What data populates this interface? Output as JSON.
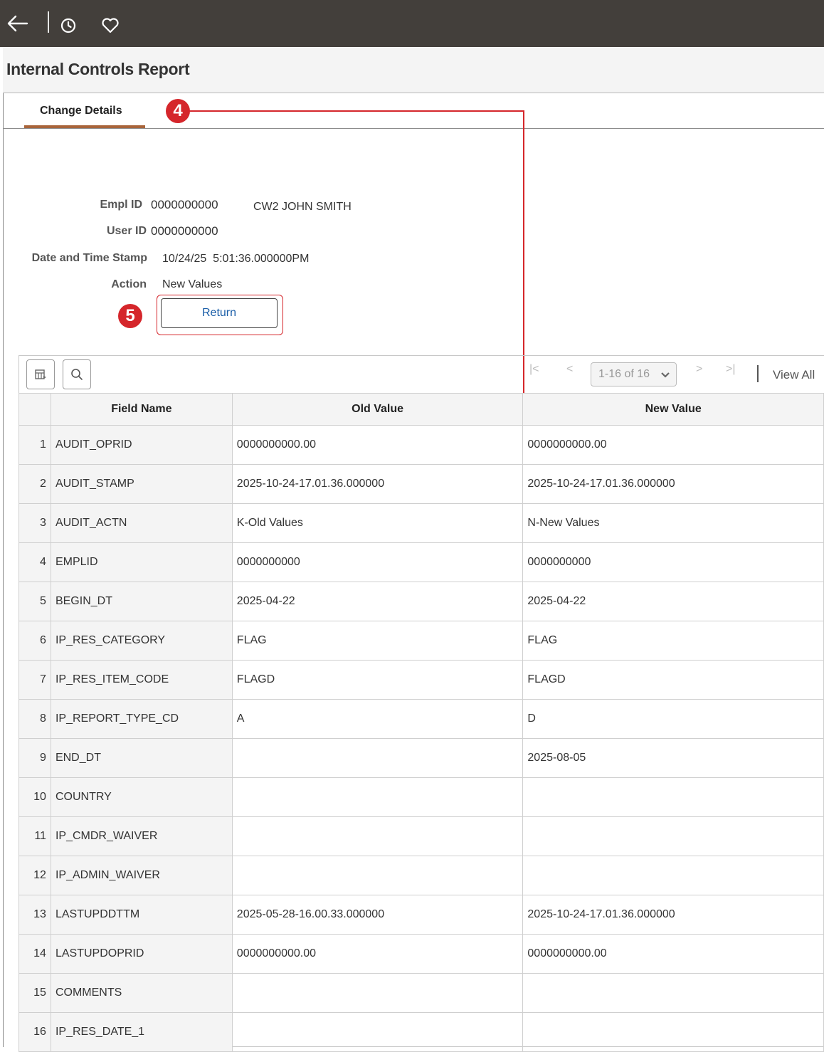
{
  "page": {
    "title": "Internal Controls Report",
    "tab": "Change Details"
  },
  "callouts": {
    "four": "4",
    "five": "5"
  },
  "form": {
    "empl_id_label": "Empl ID",
    "empl_id": "0000000000",
    "empl_name": "CW2 JOHN SMITH",
    "user_id_label": "User ID",
    "user_id": "0000000000",
    "stamp_label": "Date and Time Stamp",
    "stamp": "10/24/25  5:01:36.000000PM",
    "action_label": "Action",
    "action": "New Values",
    "return_label": "Return"
  },
  "grid": {
    "pager_text": "1-16 of 16",
    "view_all": "View All",
    "columns": [
      "Field Name",
      "Old Value",
      "New Value"
    ],
    "rows": [
      {
        "n": "1",
        "field": "AUDIT_OPRID",
        "old": "0000000000.00",
        "new": "0000000000.00"
      },
      {
        "n": "2",
        "field": "AUDIT_STAMP",
        "old": "2025-10-24-17.01.36.000000",
        "new": "2025-10-24-17.01.36.000000"
      },
      {
        "n": "3",
        "field": "AUDIT_ACTN",
        "old": "K-Old Values",
        "new": "N-New Values"
      },
      {
        "n": "4",
        "field": "EMPLID",
        "old": "0000000000",
        "new": "0000000000"
      },
      {
        "n": "5",
        "field": "BEGIN_DT",
        "old": "2025-04-22",
        "new": "2025-04-22"
      },
      {
        "n": "6",
        "field": "IP_RES_CATEGORY",
        "old": "FLAG",
        "new": "FLAG"
      },
      {
        "n": "7",
        "field": "IP_RES_ITEM_CODE",
        "old": "FLAGD",
        "new": "FLAGD"
      },
      {
        "n": "8",
        "field": "IP_REPORT_TYPE_CD",
        "old": "A",
        "new": "D"
      },
      {
        "n": "9",
        "field": "END_DT",
        "old": "",
        "new": "2025-08-05"
      },
      {
        "n": "10",
        "field": "COUNTRY",
        "old": "",
        "new": ""
      },
      {
        "n": "11",
        "field": "IP_CMDR_WAIVER",
        "old": "",
        "new": ""
      },
      {
        "n": "12",
        "field": "IP_ADMIN_WAIVER",
        "old": "",
        "new": ""
      },
      {
        "n": "13",
        "field": "LASTUPDDTTM",
        "old": "2025-05-28-16.00.33.000000",
        "new": "2025-10-24-17.01.36.000000"
      },
      {
        "n": "14",
        "field": "LASTUPDOPRID",
        "old": "0000000000.00",
        "new": "0000000000.00"
      },
      {
        "n": "15",
        "field": "COMMENTS",
        "old": "",
        "new": ""
      },
      {
        "n": "16",
        "field": "IP_RES_DATE_1",
        "old": "",
        "new": ""
      }
    ]
  },
  "colors": {
    "banner": "#433f3b",
    "callout_red": "#d5262b",
    "tab_underline": "#a8643a",
    "link_blue": "#1a5ea8"
  }
}
